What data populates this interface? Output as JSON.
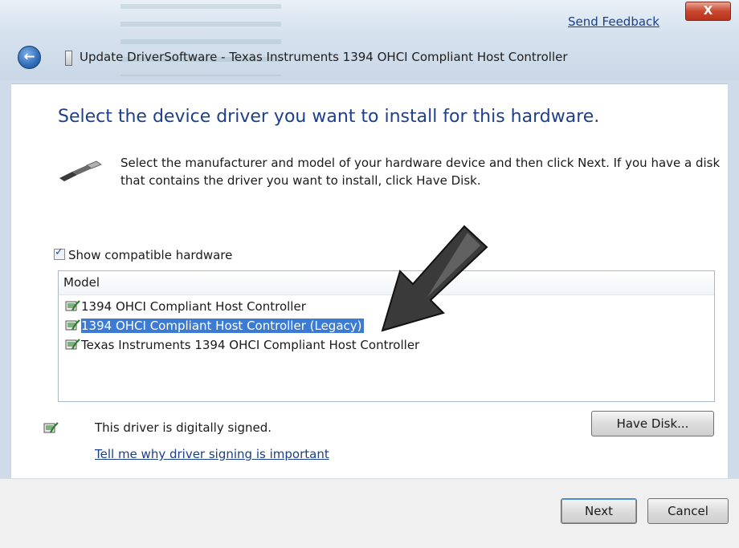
{
  "window": {
    "feedback_link": "Send Feedback",
    "close_glyph": "X",
    "back_glyph": "←",
    "title": "Update DriverSoftware - Texas Instruments 1394 OHCI Compliant Host Controller"
  },
  "main": {
    "heading": "Select the device driver you want to install for this hardware.",
    "description": "Select the manufacturer and model of your hardware device and then click Next. If you have a disk that contains the driver you want to install, click Have Disk.",
    "show_compatible_label": "Show compatible hardware",
    "show_compatible_checked": true,
    "list_header": "Model",
    "models": [
      {
        "label": "1394 OHCI Compliant Host Controller",
        "selected": false
      },
      {
        "label": "1394 OHCI Compliant Host Controller (Legacy)",
        "selected": true
      },
      {
        "label": "Texas Instruments 1394 OHCI Compliant Host Controller",
        "selected": false
      }
    ],
    "signed_text": "This driver is digitally signed.",
    "signing_link": "Tell me why driver signing is important",
    "have_disk_label": "Have Disk..."
  },
  "footer": {
    "next_label": "Next",
    "cancel_label": "Cancel"
  },
  "colors": {
    "heading": "#1e3f8a",
    "link": "#1b3f88",
    "selection": "#3d7bd3"
  }
}
